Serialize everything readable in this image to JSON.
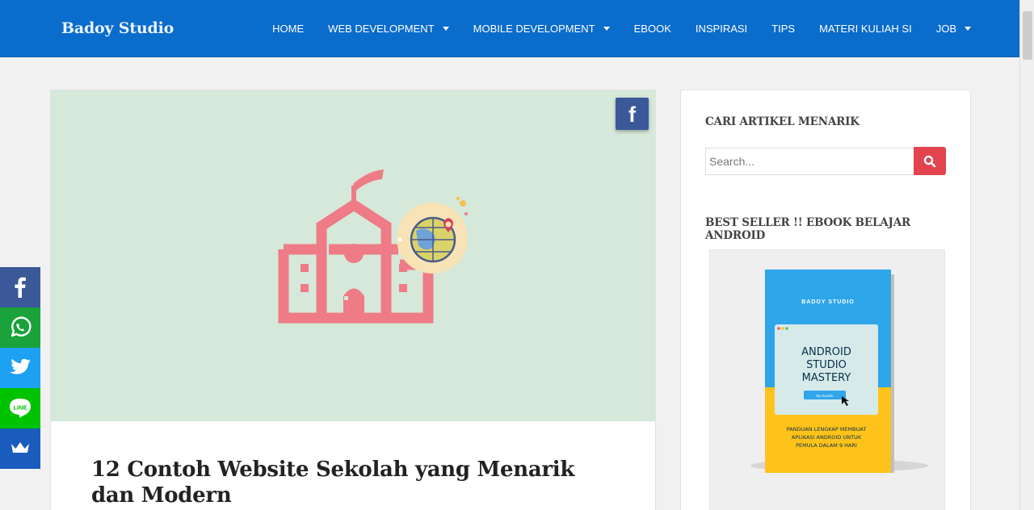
{
  "header": {
    "brand": "Badoy Studio",
    "nav": [
      {
        "label": "HOME",
        "dropdown": false
      },
      {
        "label": "WEB DEVELOPMENT",
        "dropdown": true
      },
      {
        "label": "MOBILE DEVELOPMENT",
        "dropdown": true
      },
      {
        "label": "EBOOK",
        "dropdown": false
      },
      {
        "label": "INSPIRASI",
        "dropdown": false
      },
      {
        "label": "TIPS",
        "dropdown": false
      },
      {
        "label": "MATERI KULIAH SI",
        "dropdown": false
      },
      {
        "label": "JOB",
        "dropdown": true
      }
    ]
  },
  "article": {
    "title": "12 Contoh Website Sekolah yang Menarik dan Modern",
    "hero_icon": "school-building-with-globe-pin-illustration",
    "share_icon": "facebook-icon"
  },
  "sidebar": {
    "search_title": "CARI ARTIKEL MENARIK",
    "search_placeholder": "Search...",
    "search_icon": "search-icon",
    "ebook_title": "BEST SELLER !! EBOOK BELAJAR ANDROID",
    "ebook": {
      "brand": "BADOY STUDIO",
      "title_line1": "ANDROID",
      "title_line2": "STUDIO",
      "title_line3": "MASTERY",
      "button": "By Gunhlo",
      "desc_line1": "PANDUAN LENGKAP MEMBUAT",
      "desc_line2": "APLIKASI ANDROID UNTUK",
      "desc_line3": "PEMULA DALAM 9 HARI"
    }
  },
  "share_bar": [
    {
      "name": "facebook",
      "icon": "facebook-icon",
      "color": "#3b5998"
    },
    {
      "name": "whatsapp",
      "icon": "whatsapp-icon",
      "color": "#1aa33a"
    },
    {
      "name": "twitter",
      "icon": "twitter-icon",
      "color": "#1da1f2"
    },
    {
      "name": "line",
      "icon": "line-icon",
      "color": "#00c300"
    },
    {
      "name": "sumome",
      "icon": "crown-icon",
      "color": "#1a5cbd"
    }
  ],
  "colors": {
    "header": "#0a6ccb",
    "accent_red": "#e2434f",
    "hero_bg": "#d5e8d9",
    "school_icon": "#ee7b86"
  }
}
